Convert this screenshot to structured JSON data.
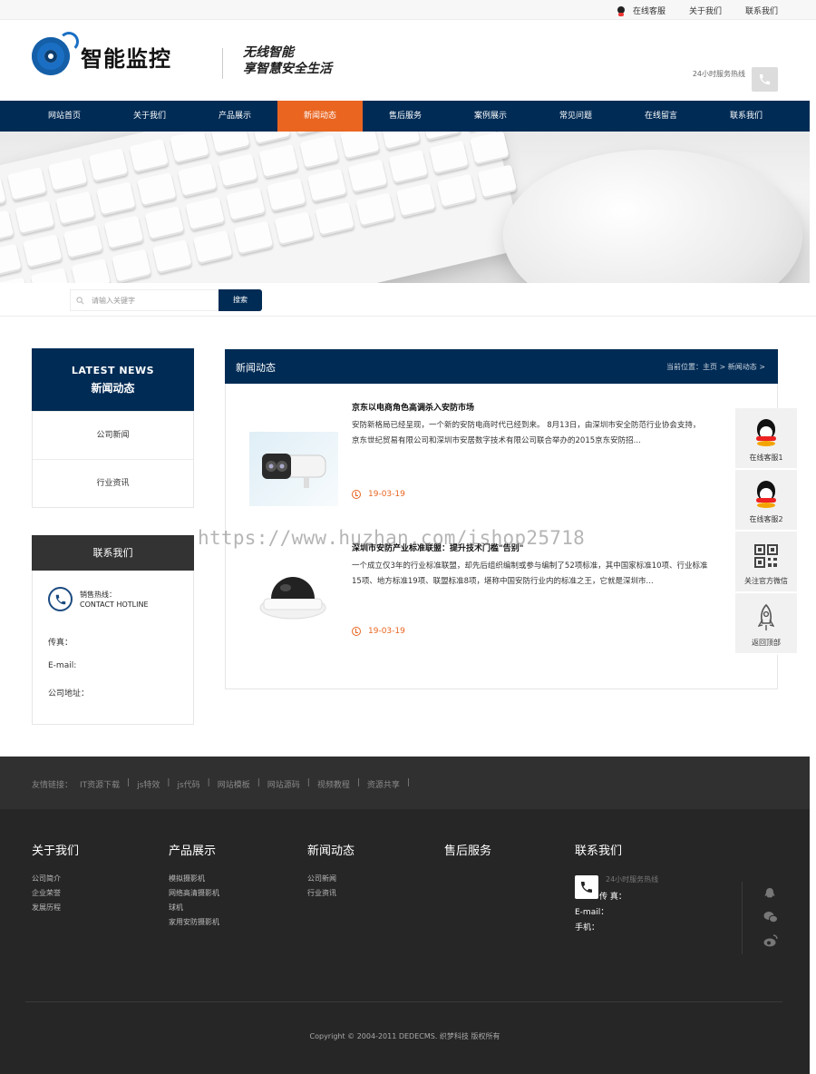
{
  "topbar": {
    "online_service": "在线客服",
    "about": "关于我们",
    "contact": "联系我们"
  },
  "header": {
    "logo_text": "智能监控",
    "slogan_line1": "无线智能",
    "slogan_line2": "享智慧安全生活",
    "hotline_label": "24小时服务热线"
  },
  "nav": {
    "items": [
      "网站首页",
      "关于我们",
      "产品展示",
      "新闻动态",
      "售后服务",
      "案例展示",
      "常见问题",
      "在线留言",
      "联系我们"
    ],
    "active_index": 3
  },
  "search": {
    "placeholder": "请输入关键字",
    "button": "搜索"
  },
  "sidebar": {
    "latest_en": "LATEST NEWS",
    "latest_cn": "新闻动态",
    "categories": [
      "公司新闻",
      "行业资讯"
    ]
  },
  "contact_box": {
    "title": "联系我们",
    "hotline_cn": "销售热线：",
    "hotline_en": "CONTACT HOTLINE",
    "fax": "传真：",
    "email": "E-mail:",
    "address": "公司地址："
  },
  "news": {
    "title": "新闻动态",
    "breadcrumb": "当前位置：主页 > 新闻动态 >",
    "items": [
      {
        "title": "京东以电商角色高调杀入安防市场",
        "desc_line1": "安防新格局已经呈现，一个新的安防电商时代已经到来。 8月13日，由深圳市安全防范行业协会支持，",
        "desc_line2": "京东世纪贸易有限公司和深圳市安居数字技术有限公司联合举办的2015京东安防招...",
        "date": "19-03-19"
      },
      {
        "title": "深圳市安防产业标准联盟：提升技术门槛\"告别\"",
        "desc_line1": "一个成立仅3年的行业标准联盟，却先后组织编制或参与编制了52项标准，其中国家标准10项、行业标准",
        "desc_line2": "15项、地方标准19项、联盟标准8项，堪称中国安防行业内的标准之王，它就是深圳市...",
        "date": "19-03-19"
      }
    ]
  },
  "watermark": "https://www.huzhan.com/ishop25718",
  "floating": {
    "items": [
      "在线客服1",
      "在线客服2",
      "关注官方微信",
      "返回顶部"
    ]
  },
  "footer_links": {
    "label": "友情链接：",
    "links": [
      "IT资源下载",
      "js特效",
      "js代码",
      "网站模板",
      "网站源码",
      "视频教程",
      "资源共享"
    ]
  },
  "footer": {
    "cols": [
      {
        "title": "关于我们",
        "links": [
          "公司简介",
          "企业荣誉",
          "发展历程"
        ]
      },
      {
        "title": "产品展示",
        "links": [
          "模拟摄影机",
          "网络高清摄影机",
          "球机",
          "家用安防摄影机"
        ]
      },
      {
        "title": "新闻动态",
        "links": [
          "公司新闻",
          "行业资讯"
        ]
      },
      {
        "title": "售后服务",
        "links": []
      }
    ],
    "contact_title": "联系我们",
    "hotline": "24小时服务热线",
    "fax": "传 真：",
    "email": "E-mail：",
    "mobile": "手机：",
    "copyright": "Copyright © 2004-2011 DEDECMS. 织梦科技 版权所有"
  },
  "colors": {
    "navy": "#002b55",
    "orange": "#e96520",
    "footer_bg": "#262626"
  }
}
